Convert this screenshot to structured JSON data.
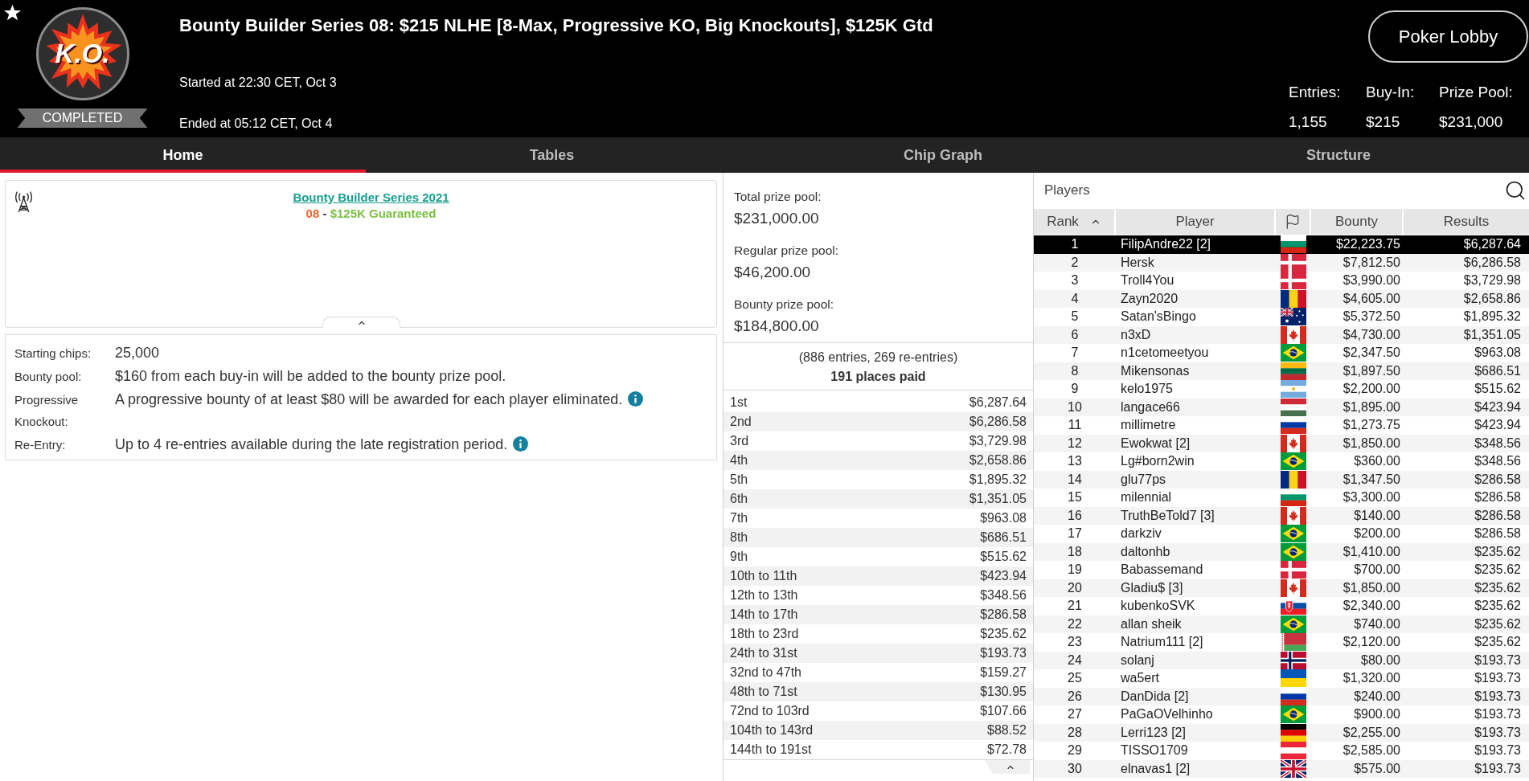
{
  "header": {
    "logo_text": "K.O.",
    "status": "COMPLETED",
    "title": "Bounty Builder Series 08: $215 NLHE [8-Max, Progressive KO, Big Knockouts], $125K Gtd",
    "started": "Started at 22:30 CET, Oct 3",
    "ended": "Ended at 05:12 CET, Oct 4",
    "lobby_button": "Poker Lobby",
    "stats": [
      {
        "label": "Entries:",
        "value": "1,155"
      },
      {
        "label": "Buy-In:",
        "value": "$215"
      },
      {
        "label": "Prize Pool:",
        "value": "$231,000"
      }
    ]
  },
  "tabs": [
    {
      "label": "Home",
      "selected": true
    },
    {
      "label": "Tables",
      "selected": false
    },
    {
      "label": "Chip Graph",
      "selected": false
    },
    {
      "label": "Structure",
      "selected": false
    }
  ],
  "overview": {
    "series_link": "Bounty Builder Series 2021",
    "event_number": "08",
    "separator": "-",
    "guarantee": "$125K Guaranteed"
  },
  "details": [
    {
      "label": "Starting chips:",
      "value": "25,000",
      "info": false
    },
    {
      "label": "Bounty pool:",
      "value": "$160 from each buy-in will be added to the bounty prize pool.",
      "info": false
    },
    {
      "label": "Progressive Knockout:",
      "value": "A progressive bounty of at least $80 will be awarded for each player eliminated.",
      "info": true
    },
    {
      "label": "Re-Entry:",
      "value": "Up to 4 re-entries available during the late registration period.",
      "info": true
    }
  ],
  "prizes": {
    "pools": [
      {
        "label": "Total prize pool:",
        "value": "$231,000.00"
      },
      {
        "label": "Regular prize pool:",
        "value": "$46,200.00"
      },
      {
        "label": "Bounty prize pool:",
        "value": "$184,800.00"
      }
    ],
    "entries_note": "(886 entries, 269 re-entries)",
    "places_paid": "191 places paid",
    "payouts": [
      {
        "place": "1st",
        "amount": "$6,287.64"
      },
      {
        "place": "2nd",
        "amount": "$6,286.58"
      },
      {
        "place": "3rd",
        "amount": "$3,729.98"
      },
      {
        "place": "4th",
        "amount": "$2,658.86"
      },
      {
        "place": "5th",
        "amount": "$1,895.32"
      },
      {
        "place": "6th",
        "amount": "$1,351.05"
      },
      {
        "place": "7th",
        "amount": "$963.08"
      },
      {
        "place": "8th",
        "amount": "$686.51"
      },
      {
        "place": "9th",
        "amount": "$515.62"
      },
      {
        "place": "10th to 11th",
        "amount": "$423.94"
      },
      {
        "place": "12th to 13th",
        "amount": "$348.56"
      },
      {
        "place": "14th to 17th",
        "amount": "$286.58"
      },
      {
        "place": "18th to 23rd",
        "amount": "$235.62"
      },
      {
        "place": "24th to 31st",
        "amount": "$193.73"
      },
      {
        "place": "32nd to 47th",
        "amount": "$159.27"
      },
      {
        "place": "48th to 71st",
        "amount": "$130.95"
      },
      {
        "place": "72nd to 103rd",
        "amount": "$107.66"
      },
      {
        "place": "104th to 143rd",
        "amount": "$88.52"
      },
      {
        "place": "144th to 191st",
        "amount": "$72.78"
      }
    ]
  },
  "players": {
    "title": "Players",
    "columns": [
      {
        "kind": "text",
        "label": "Rank",
        "sorted": true
      },
      {
        "kind": "text",
        "label": "Player",
        "sorted": false
      },
      {
        "kind": "flag",
        "sorted": false
      },
      {
        "kind": "text",
        "label": "Bounty",
        "sorted": false
      },
      {
        "kind": "text",
        "label": "Results",
        "sorted": false
      }
    ],
    "rows": [
      {
        "rank": "1",
        "player": "FilipAndre22 [2]",
        "flag": {
          "kind": "bulgaria"
        },
        "bounty": "$22,223.75",
        "result": "$6,287.64",
        "selected": true
      },
      {
        "rank": "2",
        "player": "Hersk",
        "flag": {
          "kind": "denmark"
        },
        "bounty": "$7,812.50",
        "result": "$6,286.58",
        "selected": false
      },
      {
        "rank": "3",
        "player": "Troll4You",
        "flag": {
          "kind": "denmark"
        },
        "bounty": "$3,990.00",
        "result": "$3,729.98",
        "selected": false
      },
      {
        "rank": "4",
        "player": "Zayn2020",
        "flag": {
          "kind": "romania"
        },
        "bounty": "$4,605.00",
        "result": "$2,658.86",
        "selected": false
      },
      {
        "rank": "5",
        "player": "Satan'sBingo",
        "flag": {
          "kind": "australia"
        },
        "bounty": "$5,372.50",
        "result": "$1,895.32",
        "selected": false
      },
      {
        "rank": "6",
        "player": "n3xD",
        "flag": {
          "kind": "canada"
        },
        "bounty": "$4,730.00",
        "result": "$1,351.05",
        "selected": false
      },
      {
        "rank": "7",
        "player": "n1cetomeetyou",
        "flag": {
          "kind": "brazil"
        },
        "bounty": "$2,347.50",
        "result": "$963.08",
        "selected": false
      },
      {
        "rank": "8",
        "player": "Mikensonas",
        "flag": {
          "kind": "lithuania"
        },
        "bounty": "$1,897.50",
        "result": "$686.51",
        "selected": false
      },
      {
        "rank": "9",
        "player": "kelo1975",
        "flag": {
          "kind": "argentina"
        },
        "bounty": "$2,200.00",
        "result": "$515.62",
        "selected": false
      },
      {
        "rank": "10",
        "player": "langace66",
        "flag": {
          "kind": "hungary"
        },
        "bounty": "$1,895.00",
        "result": "$423.94",
        "selected": false
      },
      {
        "rank": "11",
        "player": "millimetre",
        "flag": {
          "kind": "russia"
        },
        "bounty": "$1,273.75",
        "result": "$423.94",
        "selected": false
      },
      {
        "rank": "12",
        "player": "Ewokwat [2]",
        "flag": {
          "kind": "canada"
        },
        "bounty": "$1,850.00",
        "result": "$348.56",
        "selected": false
      },
      {
        "rank": "13",
        "player": "Lg#born2win",
        "flag": {
          "kind": "brazil"
        },
        "bounty": "$360.00",
        "result": "$348.56",
        "selected": false
      },
      {
        "rank": "14",
        "player": "glu77ps",
        "flag": {
          "kind": "romania"
        },
        "bounty": "$1,347.50",
        "result": "$286.58",
        "selected": false
      },
      {
        "rank": "15",
        "player": "milennial",
        "flag": {
          "kind": "bulgaria"
        },
        "bounty": "$3,300.00",
        "result": "$286.58",
        "selected": false
      },
      {
        "rank": "16",
        "player": "TruthBeTold7 [3]",
        "flag": {
          "kind": "canada"
        },
        "bounty": "$140.00",
        "result": "$286.58",
        "selected": false
      },
      {
        "rank": "17",
        "player": "darkziv",
        "flag": {
          "kind": "brazil"
        },
        "bounty": "$200.00",
        "result": "$286.58",
        "selected": false
      },
      {
        "rank": "18",
        "player": "daltonhb",
        "flag": {
          "kind": "brazil"
        },
        "bounty": "$1,410.00",
        "result": "$235.62",
        "selected": false
      },
      {
        "rank": "19",
        "player": "Babassemand",
        "flag": {
          "kind": "denmark"
        },
        "bounty": "$700.00",
        "result": "$235.62",
        "selected": false
      },
      {
        "rank": "20",
        "player": "Gladiu$ [3]",
        "flag": {
          "kind": "canada"
        },
        "bounty": "$1,850.00",
        "result": "$235.62",
        "selected": false
      },
      {
        "rank": "21",
        "player": "kubenkoSVK",
        "flag": {
          "kind": "slovakia"
        },
        "bounty": "$2,340.00",
        "result": "$235.62",
        "selected": false
      },
      {
        "rank": "22",
        "player": "allan sheik",
        "flag": {
          "kind": "brazil"
        },
        "bounty": "$740.00",
        "result": "$235.62",
        "selected": false
      },
      {
        "rank": "23",
        "player": "Natrium111 [2]",
        "flag": {
          "kind": "belarus"
        },
        "bounty": "$2,120.00",
        "result": "$235.62",
        "selected": false
      },
      {
        "rank": "24",
        "player": "solanj",
        "flag": {
          "kind": "norway"
        },
        "bounty": "$80.00",
        "result": "$193.73",
        "selected": false
      },
      {
        "rank": "25",
        "player": "wa5ert",
        "flag": {
          "kind": "ukraine"
        },
        "bounty": "$1,320.00",
        "result": "$193.73",
        "selected": false
      },
      {
        "rank": "26",
        "player": "DanDida [2]",
        "flag": {
          "kind": "russia"
        },
        "bounty": "$240.00",
        "result": "$193.73",
        "selected": false
      },
      {
        "rank": "27",
        "player": "PaGaOVelhinho",
        "flag": {
          "kind": "brazil"
        },
        "bounty": "$900.00",
        "result": "$193.73",
        "selected": false
      },
      {
        "rank": "28",
        "player": "Lerri123 [2]",
        "flag": {
          "kind": "germany"
        },
        "bounty": "$2,255.00",
        "result": "$193.73",
        "selected": false
      },
      {
        "rank": "29",
        "player": "TISSO1709",
        "flag": {
          "kind": "austria"
        },
        "bounty": "$2,585.00",
        "result": "$193.73",
        "selected": false
      },
      {
        "rank": "30",
        "player": "elnavas1 [2]",
        "flag": {
          "kind": "britain"
        },
        "bounty": "$575.00",
        "result": "$193.73",
        "selected": false
      }
    ]
  }
}
